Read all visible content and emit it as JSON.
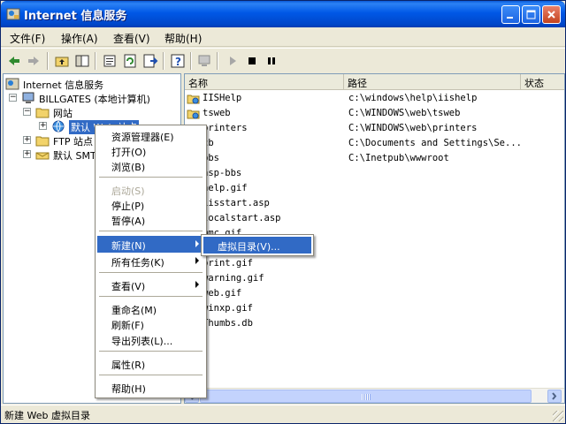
{
  "window": {
    "title": "Internet 信息服务",
    "minimize_icon": "minimize-icon",
    "maximize_icon": "maximize-icon",
    "close_icon": "close-icon"
  },
  "menubar": [
    "文件(F)",
    "操作(A)",
    "查看(V)",
    "帮助(H)"
  ],
  "toolbar": {
    "icons": [
      "back-arrow-icon",
      "forward-arrow-icon",
      "up-folder-icon",
      "show-tree-icon",
      "properties-icon",
      "refresh-icon",
      "export-list-icon",
      "help-icon",
      "computer-icon",
      "start-icon",
      "stop-icon",
      "pause-icon"
    ]
  },
  "tree": {
    "root": "Internet 信息服务",
    "computer": "BILLGATES (本地计算机)",
    "websites": "网站",
    "default_site": "默认 Web 站点",
    "ftp_sites": "FTP 站点",
    "default_smtp": "默认 SMTP 虚拟服务器"
  },
  "list": {
    "columns": [
      "名称",
      "路径",
      "状态"
    ],
    "rows": [
      {
        "name": "IISHelp",
        "path": "c:\\windows\\help\\iishelp",
        "icon": "virtual-dir-icon"
      },
      {
        "name": "tsweb",
        "path": "C:\\WINDOWS\\web\\tsweb",
        "icon": "virtual-dir-icon"
      },
      {
        "name": "printers",
        "path": "C:\\WINDOWS\\web\\printers",
        "icon": "virtual-dir-icon"
      },
      {
        "name": "cb",
        "path": "C:\\Documents and Settings\\Se...",
        "icon": "virtual-dir-icon"
      },
      {
        "name": "bbs",
        "path": "C:\\Inetpub\\wwwroot",
        "icon": "virtual-dir-icon"
      },
      {
        "name": "asp-bbs",
        "path": "",
        "icon": "folder-icon"
      },
      {
        "name": "help.gif",
        "path": "",
        "icon": "file-icon"
      },
      {
        "name": "iisstart.asp",
        "path": "",
        "icon": "file-icon"
      },
      {
        "name": "localstart.asp",
        "path": "",
        "icon": "file-icon"
      },
      {
        "name": "mmc.gif",
        "path": "",
        "icon": "file-icon"
      },
      {
        "name": "pagerror.gif",
        "path": "",
        "icon": "file-icon"
      },
      {
        "name": "print.gif",
        "path": "",
        "icon": "file-icon"
      },
      {
        "name": "warning.gif",
        "path": "",
        "icon": "file-icon"
      },
      {
        "name": "web.gif",
        "path": "",
        "icon": "file-icon"
      },
      {
        "name": "winxp.gif",
        "path": "",
        "icon": "file-icon"
      },
      {
        "name": "Thumbs.db",
        "path": "",
        "icon": "file-icon"
      }
    ]
  },
  "context_menu": {
    "items": [
      {
        "label": "资源管理器(E)",
        "disabled": false
      },
      {
        "label": "打开(O)",
        "disabled": false
      },
      {
        "label": "浏览(B)",
        "disabled": false
      },
      {
        "label": "启动(S)",
        "disabled": true
      },
      {
        "label": "停止(P)",
        "disabled": false
      },
      {
        "label": "暂停(A)",
        "disabled": false
      },
      {
        "label": "新建(N)",
        "disabled": false,
        "submenu": true,
        "highlighted": true
      },
      {
        "label": "所有任务(K)",
        "disabled": false,
        "submenu": true
      },
      {
        "label": "查看(V)",
        "disabled": false,
        "submenu": true
      },
      {
        "label": "重命名(M)",
        "disabled": false
      },
      {
        "label": "刷新(F)",
        "disabled": false
      },
      {
        "label": "导出列表(L)...",
        "disabled": false
      },
      {
        "label": "属性(R)",
        "disabled": false
      },
      {
        "label": "帮助(H)",
        "disabled": false
      }
    ]
  },
  "submenu": {
    "item": "虚拟目录(V)..."
  },
  "statusbar": {
    "text": "新建 Web 虚拟目录"
  },
  "colors": {
    "titlebar": "#0054e3",
    "selection": "#316ac5",
    "face": "#ece9d8"
  }
}
